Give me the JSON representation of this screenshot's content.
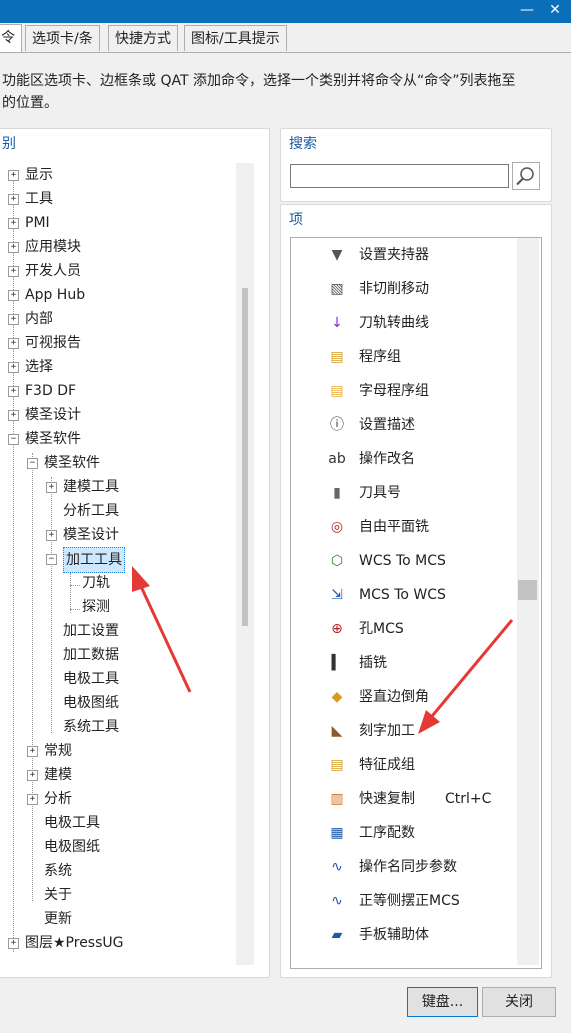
{
  "window": {
    "min_glyph": "—",
    "close_glyph": "✕"
  },
  "tabs": [
    {
      "label": "令",
      "active": true
    },
    {
      "label": "选项卡/条",
      "active": false
    },
    {
      "label": "快捷方式",
      "active": false
    },
    {
      "label": "图标/工具提示",
      "active": false
    }
  ],
  "description": {
    "line1": "功能区选项卡、边框条或 QAT 添加命令，选择一个类别并将命令从“命令”列表拖至",
    "line2": "的位置。"
  },
  "categories": {
    "label": "别",
    "tree": [
      {
        "label": "显示",
        "exp": "+"
      },
      {
        "label": "工具",
        "exp": "+"
      },
      {
        "label": "PMI",
        "exp": "+"
      },
      {
        "label": "应用模块",
        "exp": "+"
      },
      {
        "label": "开发人员",
        "exp": "+"
      },
      {
        "label": "App Hub",
        "exp": "+"
      },
      {
        "label": "内部",
        "exp": "+"
      },
      {
        "label": "可视报告",
        "exp": "+"
      },
      {
        "label": "选择",
        "exp": "+"
      },
      {
        "label": "F3D DF",
        "exp": "+"
      },
      {
        "label": "模圣设计",
        "exp": "+"
      },
      {
        "label": "模圣软件",
        "exp": "−"
      },
      {
        "label": "模圣软件",
        "exp": "−"
      },
      {
        "label": "建模工具",
        "exp": "+"
      },
      {
        "label": "分析工具",
        "exp": ""
      },
      {
        "label": "模圣设计",
        "exp": "+"
      },
      {
        "label": "加工工具",
        "exp": "−",
        "selected": true
      },
      {
        "label": "刀轨",
        "exp": ""
      },
      {
        "label": "探测",
        "exp": ""
      },
      {
        "label": "加工设置",
        "exp": ""
      },
      {
        "label": "加工数据",
        "exp": ""
      },
      {
        "label": "电极工具",
        "exp": ""
      },
      {
        "label": "电极图纸",
        "exp": ""
      },
      {
        "label": "系统工具",
        "exp": ""
      },
      {
        "label": "常规",
        "exp": "+"
      },
      {
        "label": "建模",
        "exp": "+"
      },
      {
        "label": "分析",
        "exp": "+"
      },
      {
        "label": "电极工具",
        "exp": ""
      },
      {
        "label": "电极图纸",
        "exp": ""
      },
      {
        "label": "系统",
        "exp": ""
      },
      {
        "label": "关于",
        "exp": ""
      },
      {
        "label": "更新",
        "exp": ""
      },
      {
        "label": "图层★PressUG",
        "exp": "+"
      }
    ]
  },
  "search": {
    "label": "搜索",
    "value": "",
    "icon": "magnifier-icon"
  },
  "items": {
    "label": "项",
    "list": [
      {
        "label": "设置夹持器",
        "icon": "holder-icon",
        "shortcut": ""
      },
      {
        "label": "非切削移动",
        "icon": "noncut-move-icon",
        "shortcut": ""
      },
      {
        "label": "刀轨转曲线",
        "icon": "path-to-curve-icon",
        "shortcut": ""
      },
      {
        "label": "程序组",
        "icon": "program-group-icon",
        "shortcut": ""
      },
      {
        "label": "字母程序组",
        "icon": "letter-program-group-icon",
        "shortcut": ""
      },
      {
        "label": "设置描述",
        "icon": "set-description-icon",
        "shortcut": ""
      },
      {
        "label": "操作改名",
        "icon": "rename-operation-icon",
        "shortcut": ""
      },
      {
        "label": "刀具号",
        "icon": "tool-number-icon",
        "shortcut": ""
      },
      {
        "label": "自由平面铣",
        "icon": "free-face-mill-icon",
        "shortcut": ""
      },
      {
        "label": "WCS To MCS",
        "icon": "wcs-to-mcs-icon",
        "shortcut": ""
      },
      {
        "label": "MCS To WCS",
        "icon": "mcs-to-wcs-icon",
        "shortcut": ""
      },
      {
        "label": "孔MCS",
        "icon": "hole-mcs-icon",
        "shortcut": ""
      },
      {
        "label": "插铣",
        "icon": "plunge-mill-icon",
        "shortcut": ""
      },
      {
        "label": "竖直边倒角",
        "icon": "vertical-chamfer-icon",
        "shortcut": ""
      },
      {
        "label": "刻字加工",
        "icon": "engrave-icon",
        "shortcut": ""
      },
      {
        "label": "特征成组",
        "icon": "feature-group-icon",
        "shortcut": ""
      },
      {
        "label": "快速复制",
        "icon": "quick-copy-icon",
        "shortcut": "Ctrl+C"
      },
      {
        "label": "工序配数",
        "icon": "operation-count-icon",
        "shortcut": ""
      },
      {
        "label": "操作名同步参数",
        "icon": "sync-params-icon",
        "shortcut": ""
      },
      {
        "label": "正等侧摆正MCS",
        "icon": "iso-mcs-icon",
        "shortcut": ""
      },
      {
        "label": "手板辅助体",
        "icon": "prototype-body-icon",
        "shortcut": ""
      }
    ]
  },
  "buttons": {
    "keyboard": "键盘...",
    "close": "关闭"
  },
  "colors": {
    "titlebar": "#0a6fb8",
    "selection": "#cce8ff",
    "annotation_arrow": "#e53935",
    "group_label": "#1a5aa6"
  }
}
